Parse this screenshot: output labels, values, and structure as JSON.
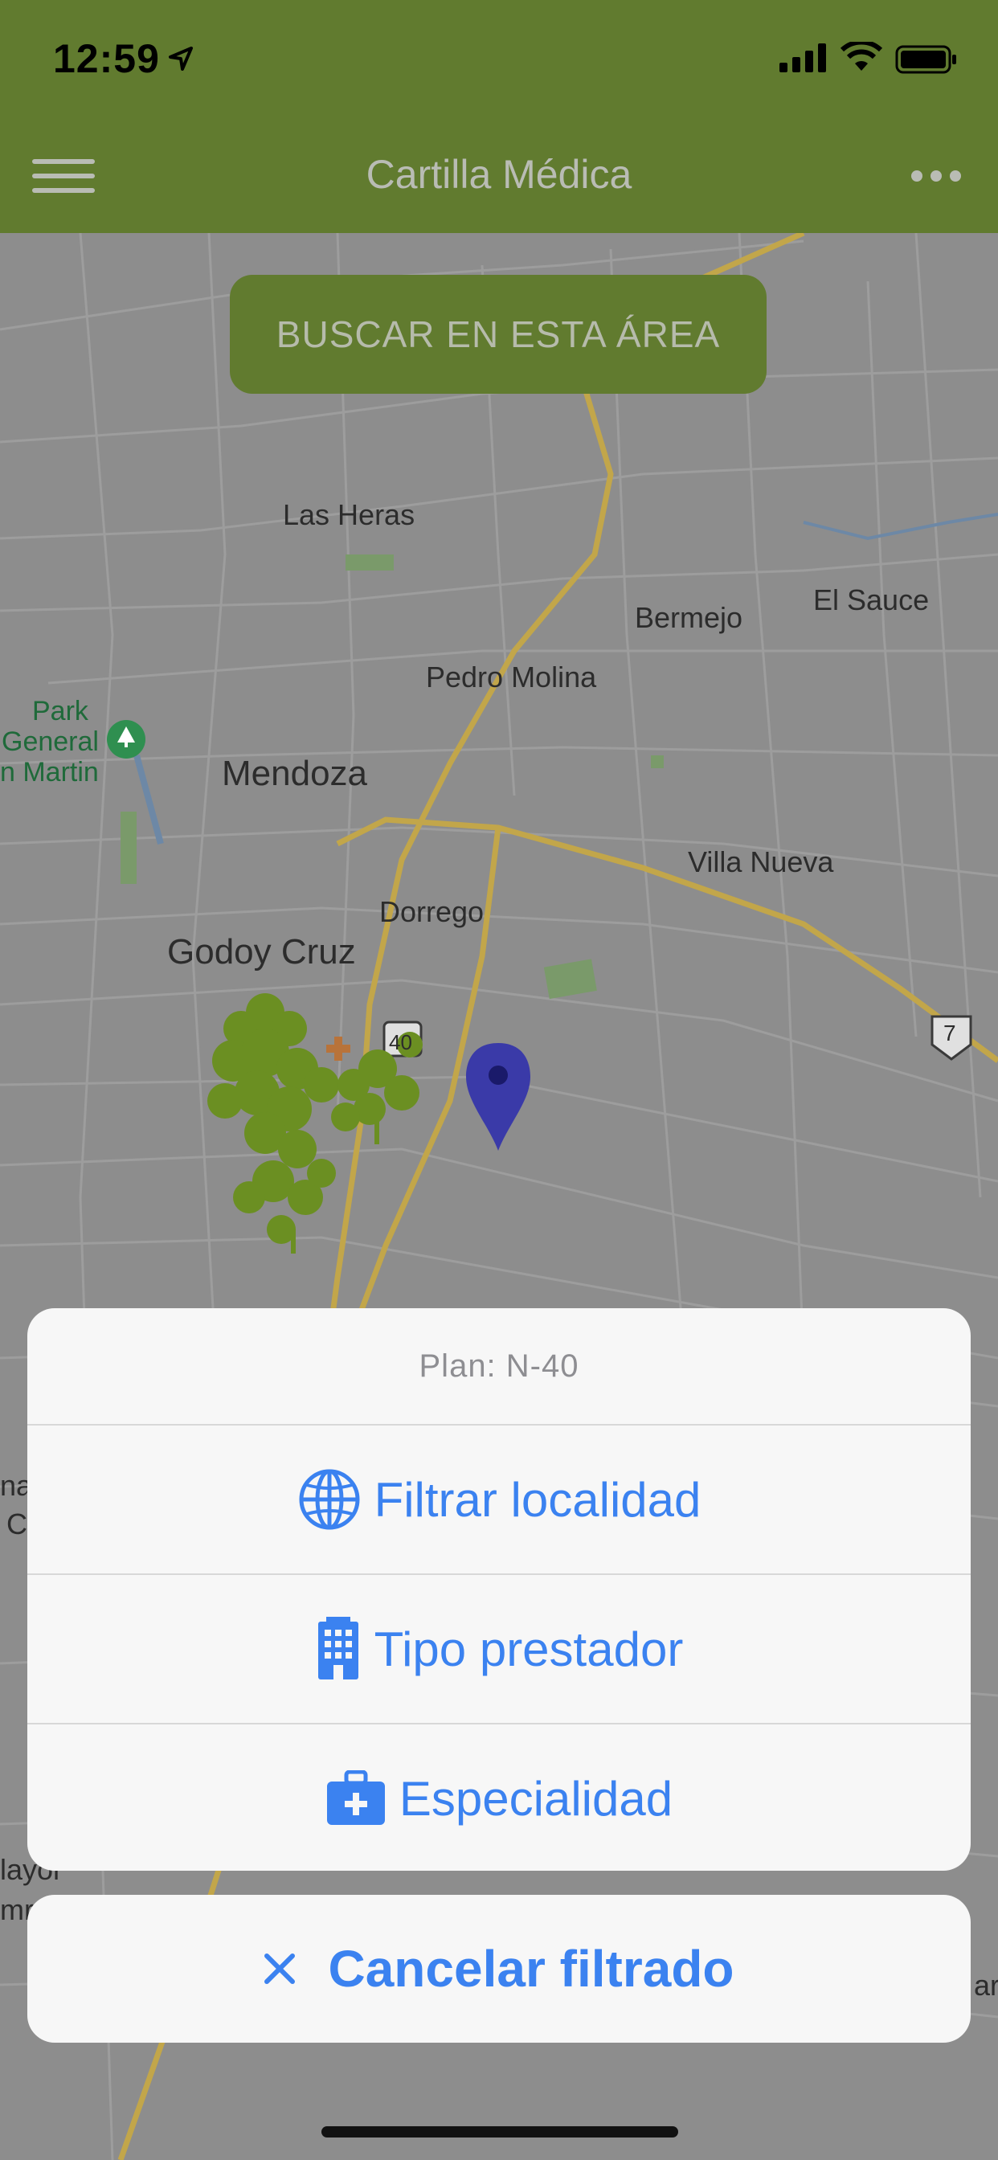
{
  "status_bar": {
    "time": "12:59"
  },
  "navbar": {
    "title": "Cartilla Médica"
  },
  "search_area_button": {
    "label": "BUSCAR EN ESTA ÁREA"
  },
  "map": {
    "labels": {
      "las_heras": "Las Heras",
      "bermejo": "Bermejo",
      "el_sauce": "El Sauce",
      "pedro_molina": "Pedro Molina",
      "park_1": "Park",
      "park_2": "General",
      "park_3": "n Martin",
      "mendoza": "Mendoza",
      "villa_nueva": "Villa Nueva",
      "dorrego": "Dorrego",
      "godoy_cruz": "Godoy Cruz",
      "route_40": "40",
      "route_7": "7",
      "partial_left_1": "na",
      "partial_left_2": "C",
      "partial_left_3": "layor",
      "partial_left_4": "mr",
      "partial_right": "ar"
    }
  },
  "action_sheet": {
    "title": "Plan: N-40",
    "options": [
      {
        "label": "Filtrar localidad",
        "icon": "globe-icon"
      },
      {
        "label": "Tipo prestador",
        "icon": "building-icon"
      },
      {
        "label": "Especialidad",
        "icon": "medical-kit-icon"
      }
    ],
    "cancel": {
      "label": "Cancelar filtrado",
      "icon": "close-icon"
    }
  },
  "colors": {
    "header_bg": "#617b2f",
    "accent_blue": "#3b82f0",
    "sheet_bg": "#f7f7f7",
    "pin_blue": "#3a3aa8",
    "tree_green": "#6b8f22"
  }
}
